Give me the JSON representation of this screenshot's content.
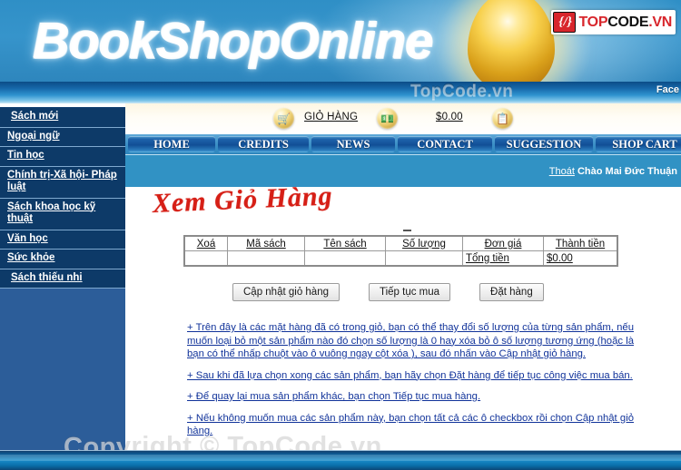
{
  "header": {
    "site_title": "BookShopOnline",
    "logo": {
      "mark": "{/}",
      "text_1": "TOP",
      "text_2": "CODE",
      "text_3": ".VN"
    },
    "watermark": "TopCode.vn",
    "face_label": "Face"
  },
  "sidebar": {
    "items": [
      {
        "label": "Sách mới",
        "indent": true
      },
      {
        "label": "Ngoại ngữ",
        "indent": false
      },
      {
        "label": "Tin học",
        "indent": false
      },
      {
        "label": "Chính trị-Xã hội- Pháp luật",
        "indent": false
      },
      {
        "label": "Sách khoa học kỹ thuật",
        "indent": false
      },
      {
        "label": "Văn học",
        "indent": false
      },
      {
        "label": "Sức khỏe",
        "indent": false
      },
      {
        "label": "Sách thiếu nhi",
        "indent": true
      }
    ]
  },
  "cartbar": {
    "cart_icon": "shopping-cart-icon",
    "cart_label": "GIỎ HÀNG",
    "money_icon": "money-icon",
    "total_value": "$0.00",
    "order_icon": "clipboard-check-icon"
  },
  "nav": {
    "items": [
      {
        "label": "HOME"
      },
      {
        "label": "CREDITS"
      },
      {
        "label": "NEWS"
      },
      {
        "label": "CONTACT"
      },
      {
        "label": "SUGGESTION"
      },
      {
        "label": "SHOP CART"
      }
    ]
  },
  "account": {
    "logout_label": "Thoát",
    "greeting": "Chào Mai Đức Thuận"
  },
  "main": {
    "page_title": "Xem Giỏ Hàng",
    "table": {
      "headers": [
        "Xoá",
        "Mã sách",
        "Tên sách",
        "Số lượng",
        "Đơn giá",
        "Thành tiền"
      ],
      "rows": [
        [
          "",
          "",
          "",
          "",
          "Tổng tiền",
          "$0.00"
        ]
      ]
    },
    "buttons": [
      {
        "label": "Cập nhật giỏ hàng"
      },
      {
        "label": "Tiếp tục mua"
      },
      {
        "label": "Đặt hàng"
      }
    ],
    "notes": [
      "+ Trên đây là các mặt hàng đã có trong giỏ, bạn có thể thay đổi số lượng của từng sản phẩm, nếu muốn loại bỏ một sản phẩm nào đó chọn số lượng là 0 hay xóa bỏ ô số lượng tương ứng (hoặc là bạn có thể nhấp chuột vào ô vuông ngay cột xóa ), sau đó nhấn vào Cập nhật giỏ hàng.",
      "+ Sau khi đã lựa chọn xong các sản phẩm, bạn hãy chọn Đặt hàng để tiếp tục công việc mua bán.",
      "+ Để quay lại mua sản phẩm khác, bạn chọn Tiếp tục mua hàng.",
      "+ Nếu không muốn mua các sản phẩm này, bạn chọn tất cả các ô checkbox rồi chọn Cập nhật giỏ hàng."
    ]
  },
  "overlay": {
    "watermark": "Copyright © TopCode.vn"
  },
  "colors": {
    "banner_blue": "#3694cb",
    "sidebar_blue": "#2c5d99",
    "sidebar_item_blue": "#0d3a68",
    "band_blue": "#3192c4",
    "title_red": "#d61f16",
    "note_blue": "#11339a",
    "logo_red": "#d8262c"
  }
}
